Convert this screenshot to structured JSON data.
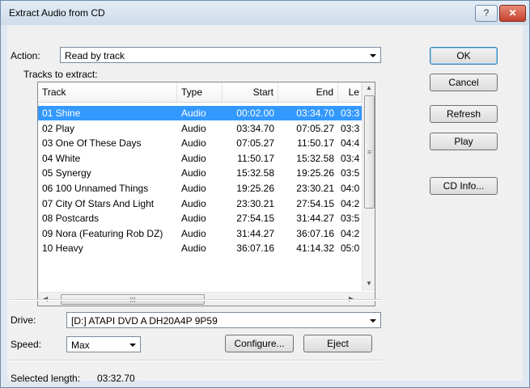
{
  "window": {
    "title": "Extract Audio from CD",
    "help_label": "?",
    "close_label": "✕"
  },
  "action": {
    "label": "Action:",
    "value": "Read by track"
  },
  "tracks": {
    "label": "Tracks to extract:",
    "columns": [
      "Track",
      "Type",
      "Start",
      "End",
      "Le"
    ],
    "rows": [
      {
        "track": "01 Shine",
        "type": "Audio",
        "start": "00:02.00",
        "end": "03:34.70",
        "len": "03:3",
        "selected": true
      },
      {
        "track": "02 Play",
        "type": "Audio",
        "start": "03:34.70",
        "end": "07:05.27",
        "len": "03:3",
        "selected": false
      },
      {
        "track": "03 One Of These Days",
        "type": "Audio",
        "start": "07:05.27",
        "end": "11:50.17",
        "len": "04:4",
        "selected": false
      },
      {
        "track": "04 White",
        "type": "Audio",
        "start": "11:50.17",
        "end": "15:32.58",
        "len": "03:4",
        "selected": false
      },
      {
        "track": "05 Synergy",
        "type": "Audio",
        "start": "15:32.58",
        "end": "19:25.26",
        "len": "03:5",
        "selected": false
      },
      {
        "track": "06 100 Unnamed Things",
        "type": "Audio",
        "start": "19:25.26",
        "end": "23:30.21",
        "len": "04:0",
        "selected": false
      },
      {
        "track": "07 City Of Stars And Light",
        "type": "Audio",
        "start": "23:30.21",
        "end": "27:54.15",
        "len": "04:2",
        "selected": false
      },
      {
        "track": "08 Postcards",
        "type": "Audio",
        "start": "27:54.15",
        "end": "31:44.27",
        "len": "03:5",
        "selected": false
      },
      {
        "track": "09 Nora (Featuring Rob DZ)",
        "type": "Audio",
        "start": "31:44.27",
        "end": "36:07.16",
        "len": "04:2",
        "selected": false
      },
      {
        "track": "10 Heavy",
        "type": "Audio",
        "start": "36:07.16",
        "end": "41:14.32",
        "len": "05:0",
        "selected": false
      }
    ],
    "hscroll_grip": "III"
  },
  "drive": {
    "label": "Drive:",
    "value": "[D:] ATAPI DVD A  DH20A4P 9P59"
  },
  "speed": {
    "label": "Speed:",
    "value": "Max"
  },
  "buttons": {
    "ok": "OK",
    "cancel": "Cancel",
    "refresh": "Refresh",
    "play": "Play",
    "cd_info": "CD Info...",
    "configure": "Configure...",
    "eject": "Eject"
  },
  "status": {
    "selected_length_label": "Selected length:",
    "selected_length_value": "03:32.70"
  },
  "colors": {
    "selection": "#3399ff",
    "titlebar": "#dfe8f2",
    "close": "#c5422c"
  }
}
